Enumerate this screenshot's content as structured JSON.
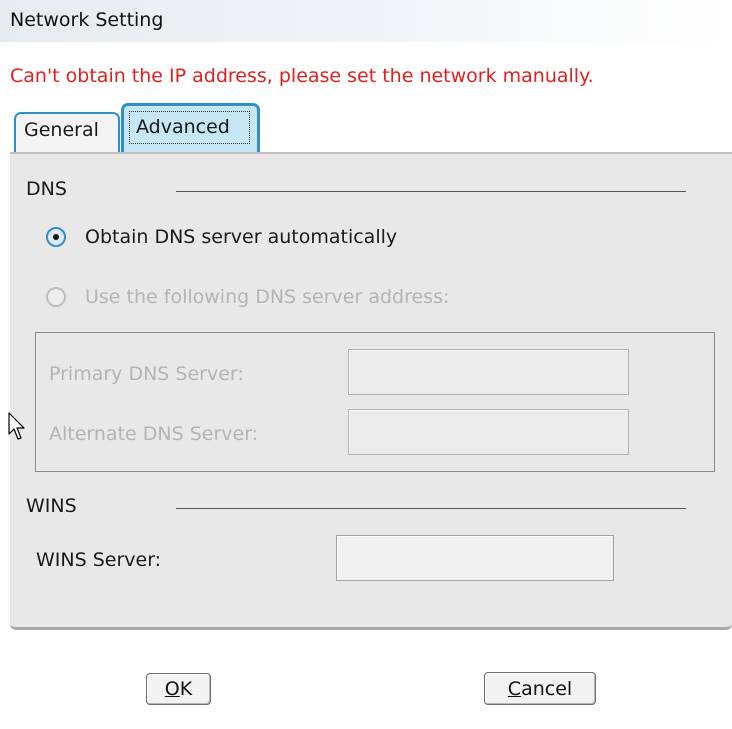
{
  "window": {
    "title": "Network Setting"
  },
  "error_message": "Can't obtain the IP address, please set the network manually.",
  "tabs": [
    {
      "label": "General",
      "selected": false
    },
    {
      "label": "Advanced",
      "selected": true
    }
  ],
  "dns": {
    "section_label": "DNS",
    "auto_option": {
      "label": "Obtain DNS server automatically",
      "checked": true,
      "enabled": true
    },
    "manual_option": {
      "label": "Use the following DNS server address:",
      "checked": false,
      "enabled": false
    },
    "primary": {
      "label": "Primary DNS Server:",
      "value": "",
      "enabled": false
    },
    "alternate": {
      "label": "Alternate DNS Server:",
      "value": "",
      "enabled": false
    }
  },
  "wins": {
    "section_label": "WINS",
    "server": {
      "label": "WINS Server:",
      "value": "",
      "enabled": true
    }
  },
  "buttons": {
    "ok": {
      "mnemonic": "O",
      "rest": "K"
    },
    "cancel": {
      "mnemonic": "C",
      "rest": "ancel"
    }
  },
  "colors": {
    "error_text": "#e02020",
    "tab_border": "#2f8fc8",
    "selected_tab_bg": "#c7e6f4",
    "panel_bg": "#e8e8e8",
    "disabled_text": "#b4b4b4"
  },
  "icons": [
    "radio-selected-icon",
    "radio-unselected-icon",
    "mouse-pointer-icon"
  ]
}
